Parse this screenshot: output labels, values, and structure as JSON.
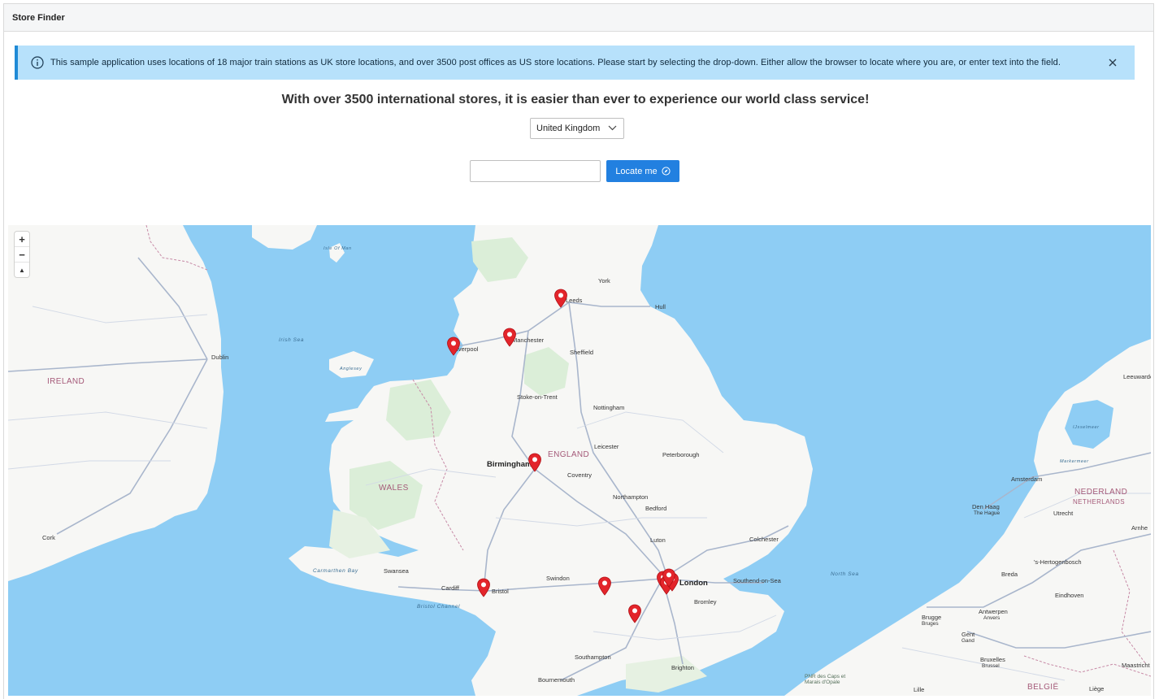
{
  "window": {
    "title": "Store Finder"
  },
  "alert": {
    "message": "This sample application uses locations of 18 major train stations as UK store locations, and over 3500 post offices as US store locations. Please start by selecting the drop-down. Either allow the browser to locate where you are, or enter text into the field.",
    "close_icon": "close-icon",
    "info_icon": "info-icon"
  },
  "headline": "With over 3500 international stores, it is easier than ever to experience our world class service!",
  "country_select": {
    "value": "United Kingdom"
  },
  "search": {
    "value": "",
    "placeholder": ""
  },
  "locate_button": {
    "label": "Locate me",
    "icon": "compass-icon"
  },
  "map": {
    "zoom_in": "+",
    "zoom_out": "−",
    "reset_north": "▲",
    "countries": {
      "ireland": "IRELAND",
      "wales": "WALES",
      "england": "ENGLAND",
      "nederland": "NEDERLAND",
      "netherlands": "NETHERLANDS",
      "belgie": "BELGIË"
    },
    "seas": {
      "irish_sea": "Irish Sea",
      "north_sea": "North Sea",
      "bristol_channel": "Bristol Channel",
      "carmarthen_bay": "Carmarthen Bay",
      "isle_of_man": "Isle Of Man",
      "ijsselmeer": "IJsselmeer",
      "markermeer": "Markermeer",
      "anglesey": "Anglesey"
    },
    "cities": {
      "york": "York",
      "leeds": "Leeds",
      "hull": "Hull",
      "liverpool": "Liverpool",
      "manchester": "Manchester",
      "sheffield": "Sheffield",
      "dublin": "Dublin",
      "stoke": "Stoke-on-Trent",
      "nottingham": "Nottingham",
      "leicester": "Leicester",
      "peterborough": "Peterborough",
      "birmingham": "Birmingham",
      "coventry": "Coventry",
      "northampton": "Northampton",
      "bedford": "Bedford",
      "luton": "Luton",
      "colchester": "Colchester",
      "cork": "Cork",
      "swansea": "Swansea",
      "cardiff": "Cardiff",
      "bristol": "Bristol",
      "swindon": "Swindon",
      "london": "London",
      "southend": "Southend-on-Sea",
      "bromley": "Bromley",
      "southampton": "Southampton",
      "bournemouth": "Bournemouth",
      "brighton": "Brighton",
      "leeuwarden": "Leeuwarden",
      "amsterdam": "Amsterdam",
      "den_haag": "Den Haag",
      "the_hague": "The Hague",
      "utrecht": "Utrecht",
      "arnhem": "Arnhe",
      "hertogenbosch": "'s-Hertogenbosch",
      "breda": "Breda",
      "eindhoven": "Eindhoven",
      "antwerpen": "Antwerpen",
      "anvers": "Anvers",
      "brugge": "Brugge",
      "bruges": "Bruges",
      "gent": "Gent",
      "gand": "Gand",
      "bruxelles": "Bruxelles",
      "brussel": "Brussel",
      "maastricht": "Maastricht",
      "liege": "Liège",
      "lille": "Lille",
      "opal": "PNR des Caps et Marais d'Opale"
    },
    "store_pin_icon": "map-pin-icon"
  }
}
